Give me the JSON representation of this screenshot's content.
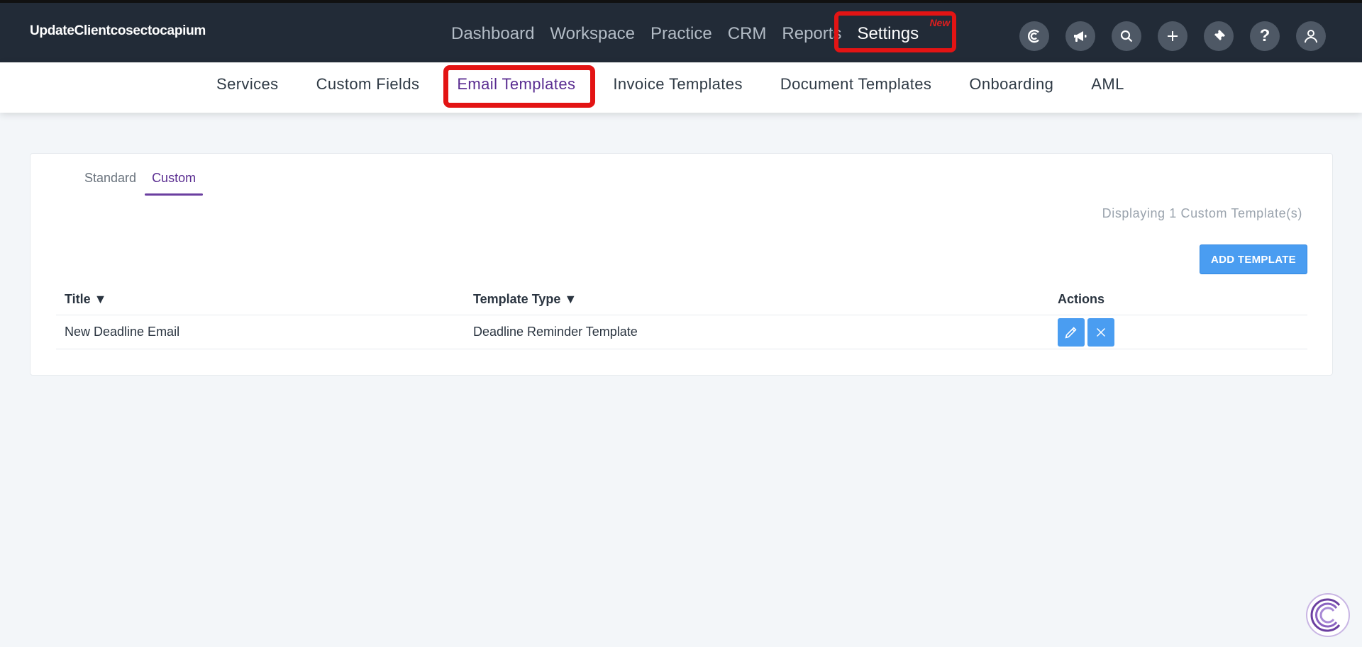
{
  "header": {
    "brand": "UpdateClientcosectocapium",
    "nav": [
      {
        "label": "Dashboard"
      },
      {
        "label": "Workspace"
      },
      {
        "label": "Practice"
      },
      {
        "label": "CRM"
      },
      {
        "label": "Reports"
      }
    ],
    "settings": {
      "label": "Settings",
      "badge": "New"
    },
    "icons": [
      "capium-logo-icon",
      "megaphone-icon",
      "search-icon",
      "plus-icon",
      "ticket-icon",
      "help-icon",
      "user-icon"
    ],
    "help_label": "?"
  },
  "subnav": {
    "items": [
      {
        "label": "Services"
      },
      {
        "label": "Custom Fields"
      },
      {
        "label": "Email Templates"
      },
      {
        "label": "Invoice Templates"
      },
      {
        "label": "Document Templates"
      },
      {
        "label": "Onboarding"
      },
      {
        "label": "AML"
      }
    ],
    "active": "Email Templates"
  },
  "card": {
    "tabs": [
      {
        "label": "Standard"
      },
      {
        "label": "Custom"
      }
    ],
    "active_tab": "Custom",
    "displaying": "Displaying 1 Custom Template(s)",
    "add_button": "ADD TEMPLATE",
    "table": {
      "headers": {
        "title": "Title ▼",
        "type": "Template Type ▼",
        "actions": "Actions"
      },
      "rows": [
        {
          "title": "New Deadline Email",
          "type": "Deadline Reminder Template"
        }
      ]
    }
  },
  "colors": {
    "topbar": "#222b37",
    "accent_purple": "#5a2d91",
    "button_blue": "#4a9df1",
    "highlight_red": "#e31414"
  }
}
